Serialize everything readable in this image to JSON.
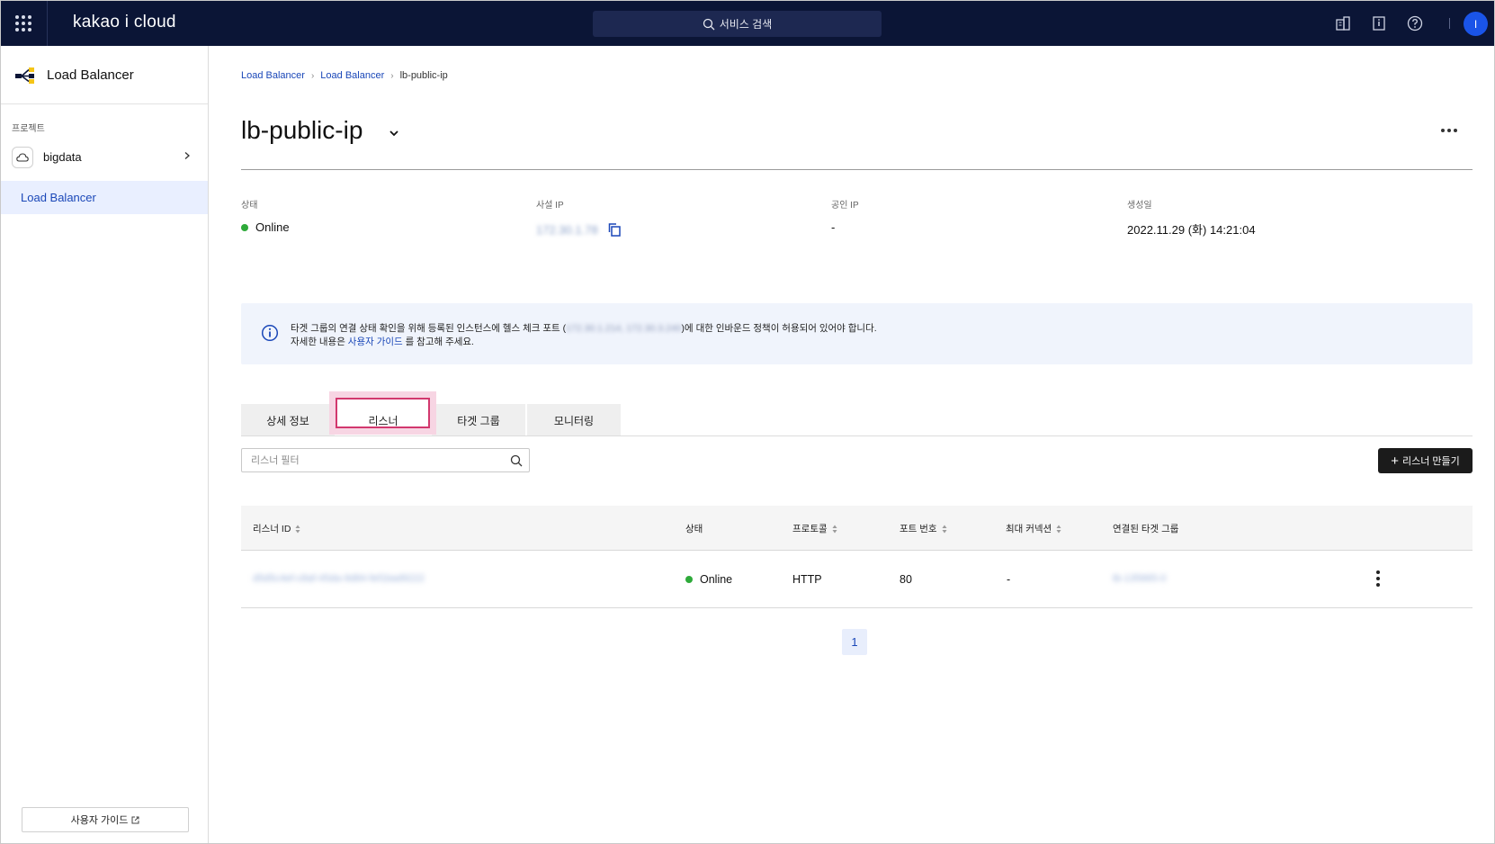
{
  "topbar": {
    "logo": "kakao i cloud",
    "search_placeholder": "서비스 검색",
    "avatar_initial": "I",
    "icons": [
      "apps-grid-icon",
      "building-icon",
      "info-card-icon",
      "help-icon"
    ]
  },
  "sidebar": {
    "service_title": "Load Balancer",
    "project_label": "프로젝트",
    "project_name": "bigdata",
    "items": [
      {
        "label": "Load Balancer",
        "active": true
      }
    ],
    "guide_button": "사용자 가이드"
  },
  "breadcrumb": [
    "Load Balancer",
    "Load Balancer",
    "lb-public-ip"
  ],
  "page": {
    "title": "lb-public-ip"
  },
  "info": {
    "status_label": "상태",
    "status_value": "Online",
    "private_ip_label": "사설 IP",
    "private_ip_value": "172.30.1.78",
    "public_ip_label": "공인 IP",
    "public_ip_value": "-",
    "created_label": "생성일",
    "created_value": "2022.11.29 (화) 14:21:04"
  },
  "notice": {
    "line1_prefix": "타겟 그룹의 연결 상태 확인을 위해 등록된 인스턴스에 헬스 체크 포트 (",
    "line1_ips": "172.30.1.214, 172.30.3.240",
    "line1_suffix": ")에 대한 인바운드 정책이 허용되어 있어야 합니다.",
    "line2_prefix": "자세한 내용은 ",
    "line2_link": "사용자 가이드",
    "line2_suffix": " 를 참고해 주세요."
  },
  "tabs": [
    {
      "label": "상세 정보",
      "active": false
    },
    {
      "label": "리스너",
      "active": true
    },
    {
      "label": "타겟 그룹",
      "active": false
    },
    {
      "label": "모니터링",
      "active": false
    }
  ],
  "filter": {
    "placeholder": "리스너 필터"
  },
  "create_button": "리스너 만들기",
  "table": {
    "headers": {
      "id": "리스너 ID",
      "status": "상태",
      "protocol": "프로토콜",
      "port": "포트 번호",
      "max_conn": "최대 커넥션",
      "target_group": "연결된 타겟 그룹"
    },
    "rows": [
      {
        "id": "d5d5c4ef-c8af-45da-9d84-fef1bad9222",
        "status": "Online",
        "protocol": "HTTP",
        "port": "80",
        "max_conn": "-",
        "target_group": "tb-135665-0"
      }
    ]
  },
  "pagination": {
    "current": "1"
  },
  "colors": {
    "topbar_bg": "#0b1536",
    "accent": "#1a47b8",
    "status_online": "#2eaa3a",
    "tab_highlight": "#d2386e",
    "avatar": "#1a54e8"
  }
}
